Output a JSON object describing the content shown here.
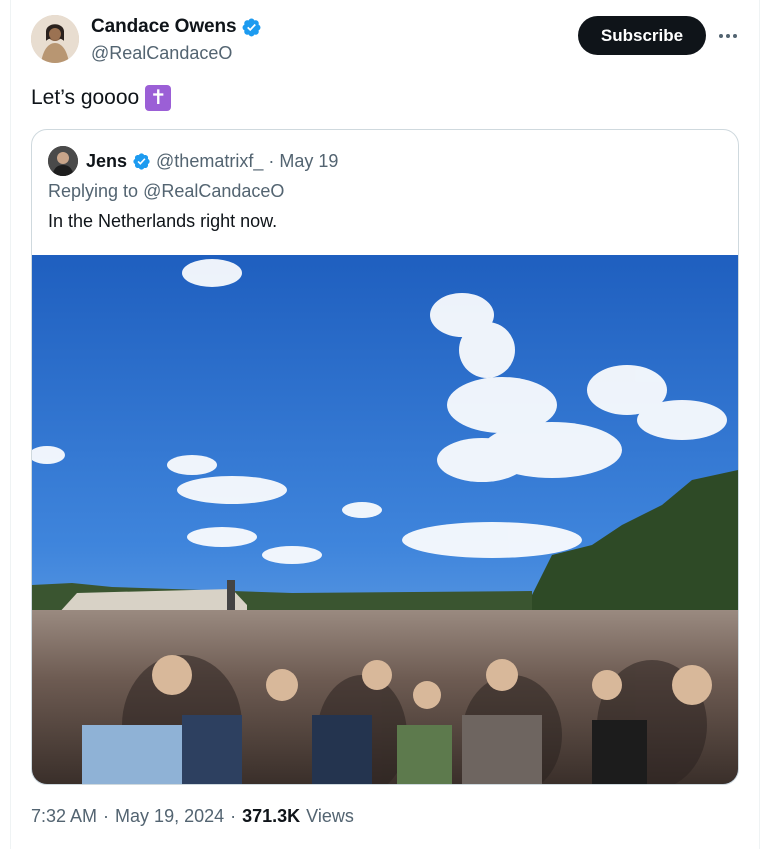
{
  "author": {
    "display_name": "Candace Owens",
    "handle": "@RealCandaceO",
    "verified": true,
    "avatar_icon": "profile-photo"
  },
  "actions": {
    "subscribe_label": "Subscribe",
    "more_icon": "more-horizontal-icon"
  },
  "tweet": {
    "text": "Let’s goooo",
    "emoji": "✝"
  },
  "quoted_tweet": {
    "display_name": "Jens",
    "handle": "@thematrixf_",
    "separator": "·",
    "date": "May 19",
    "reply_prefix": "Replying to",
    "reply_to": "@RealCandaceO",
    "text": "In the Netherlands right now."
  },
  "meta": {
    "time": "7:32 AM",
    "sep1": "·",
    "date": "May 19, 2024",
    "sep2": "·",
    "views_count": "371.3K",
    "views_label": "Views"
  },
  "colors": {
    "verified_badge": "#1d9bf0",
    "primary_text": "#0f1419",
    "secondary_text": "#536471",
    "border": "#cfd9de",
    "subscribe_bg": "#0f1419",
    "emoji_bg": "#9b5fd6"
  }
}
